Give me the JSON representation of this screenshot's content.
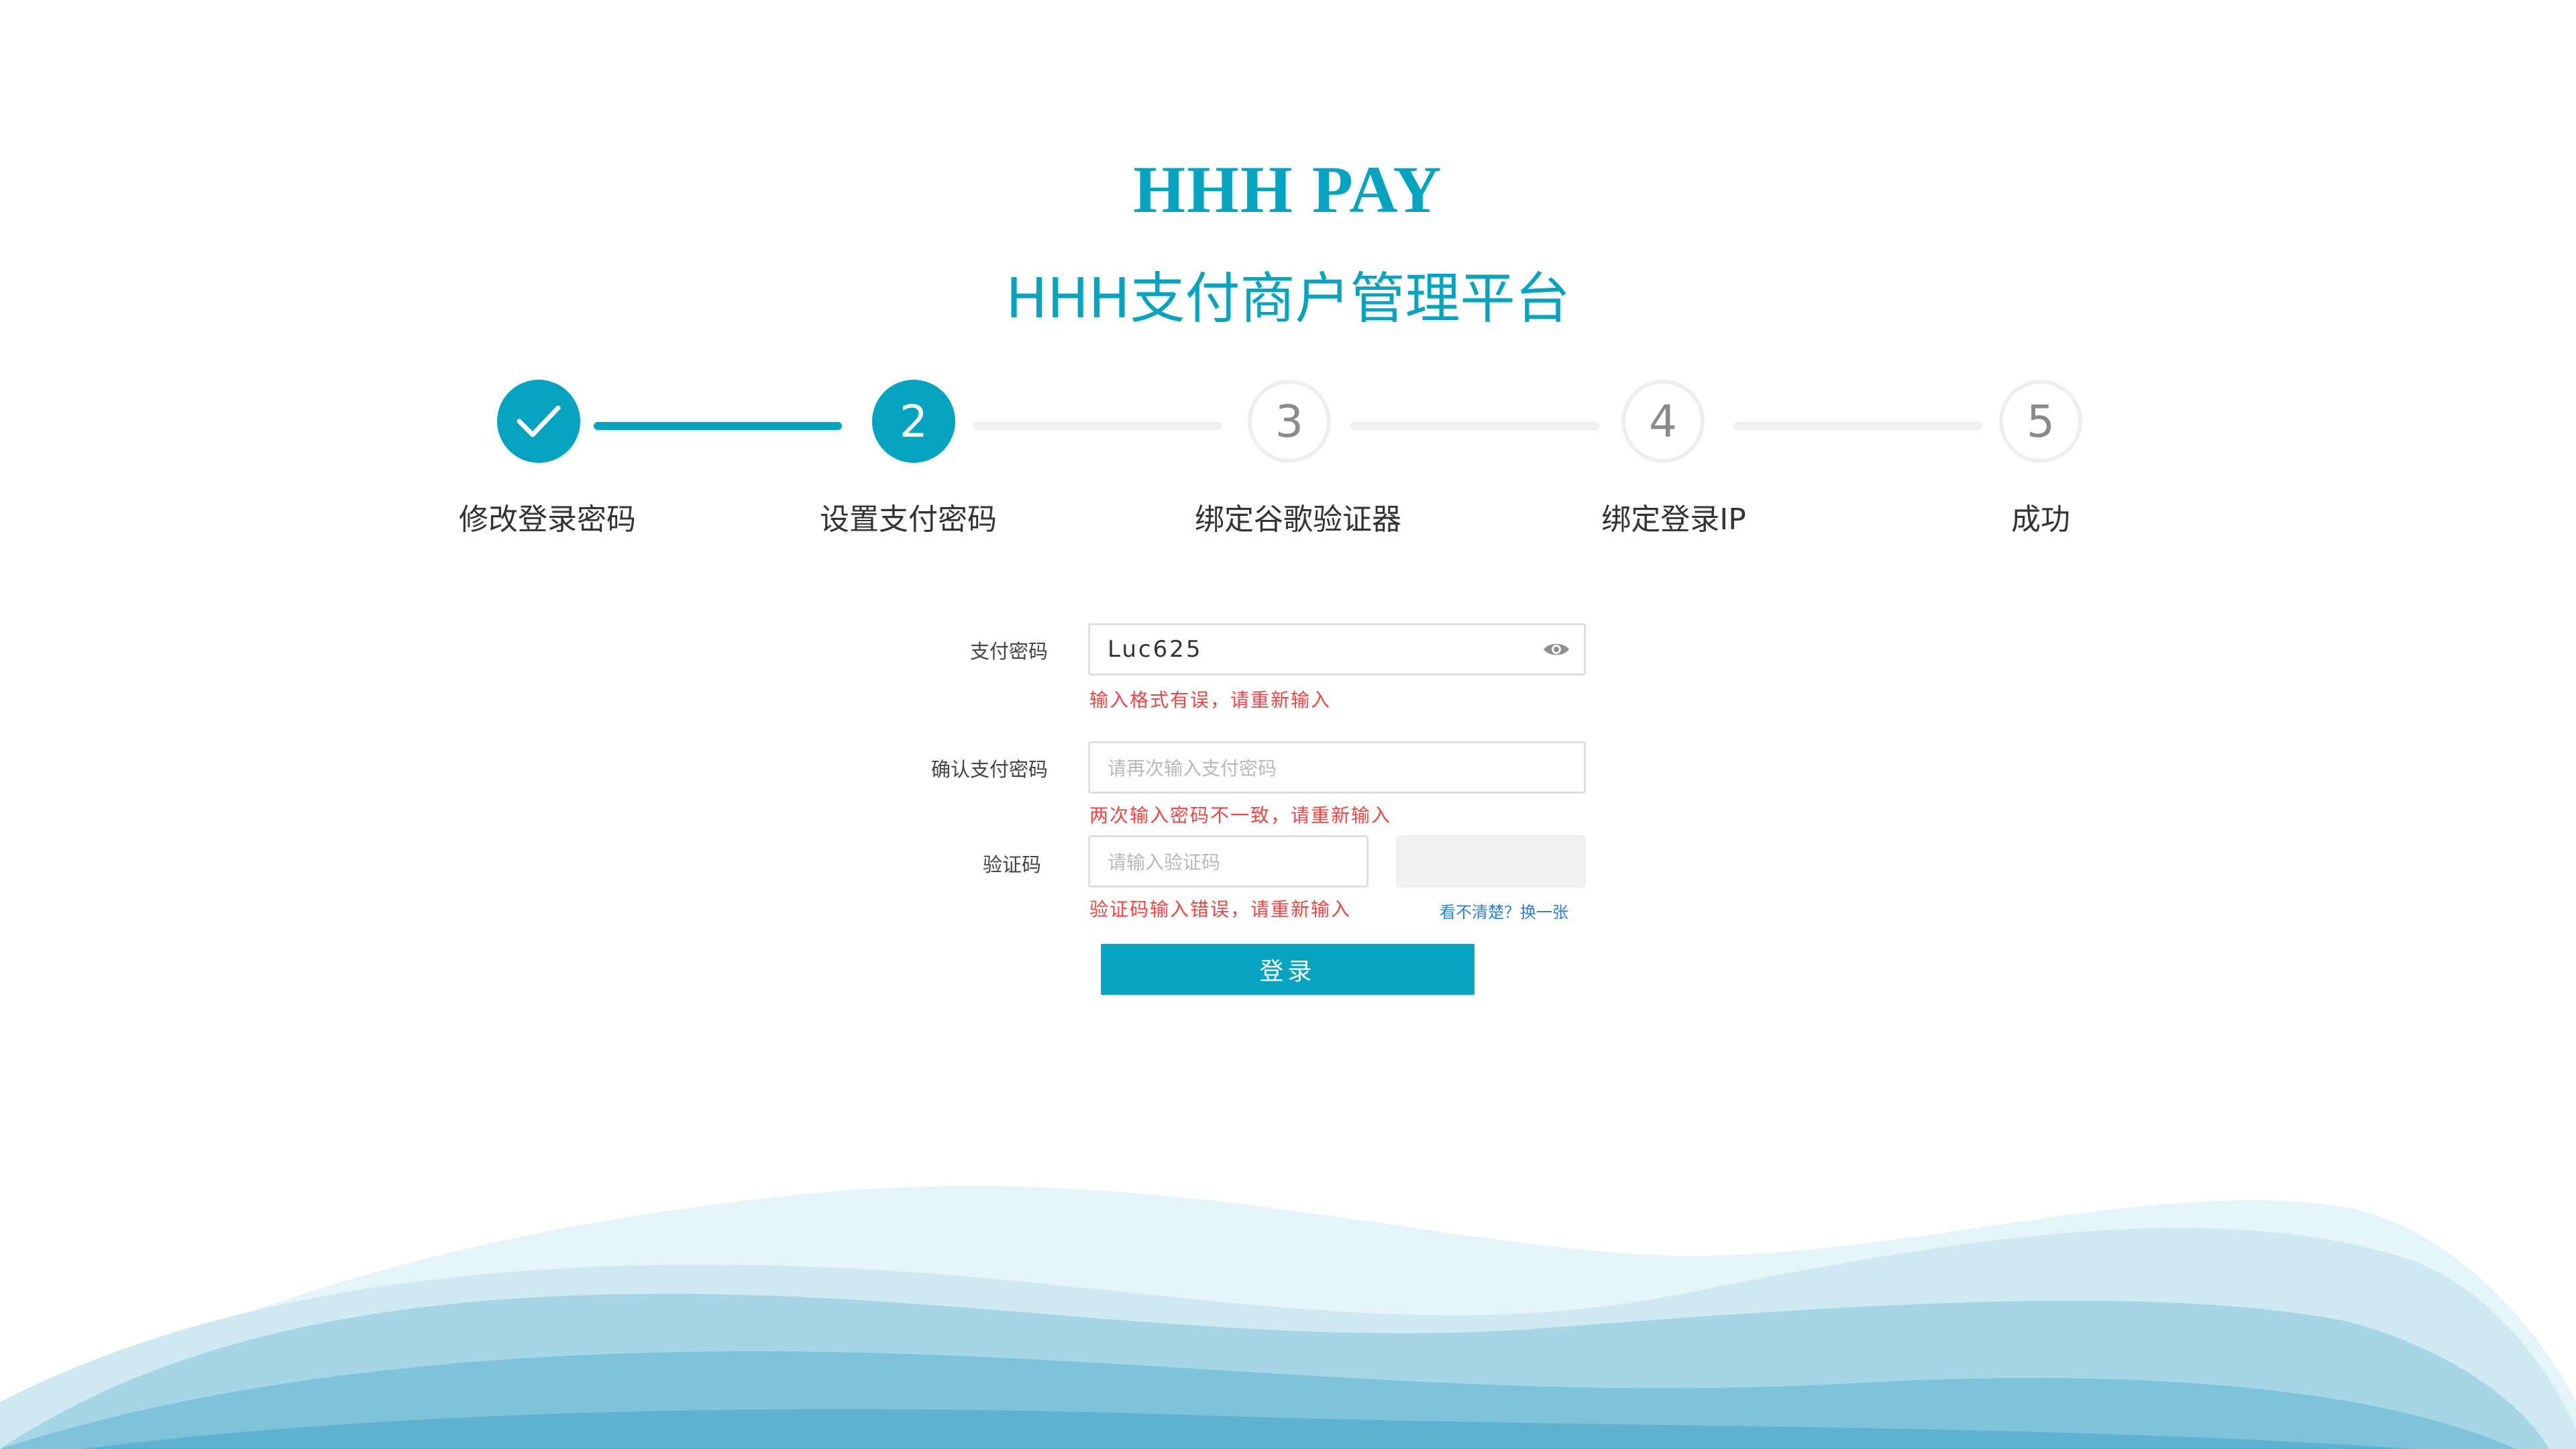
{
  "header": {
    "brand_title": "HHH PAY",
    "brand_subtitle": "HHH支付商户管理平台"
  },
  "steps": {
    "items": [
      {
        "number": "1",
        "label": "修改登录密码",
        "status": "done"
      },
      {
        "number": "2",
        "label": "设置支付密码",
        "status": "active"
      },
      {
        "number": "3",
        "label": "绑定谷歌验证器",
        "status": "todo"
      },
      {
        "number": "4",
        "label": "绑定登录IP",
        "status": "todo"
      },
      {
        "number": "5",
        "label": "成功",
        "status": "todo"
      }
    ]
  },
  "form": {
    "pay_password": {
      "label": "支付密码",
      "value": "Luc625",
      "error": "输入格式有误，请重新输入"
    },
    "confirm_password": {
      "label": "确认支付密码",
      "placeholder": "请再次输入支付密码",
      "error": "两次输入密码不一致，请重新输入"
    },
    "captcha": {
      "label": "验证码",
      "placeholder": "请输入验证码",
      "error": "验证码输入错误，请重新输入",
      "refresh_text": "看不清楚？换一张"
    },
    "submit_label": "登录"
  },
  "colors": {
    "accent": "#05a3bf",
    "error": "#f04545",
    "link": "#2d7fd6",
    "inactive_step": "#eeeeee"
  },
  "icons": {
    "step_done": "check-icon",
    "password_toggle": "eye-icon"
  }
}
